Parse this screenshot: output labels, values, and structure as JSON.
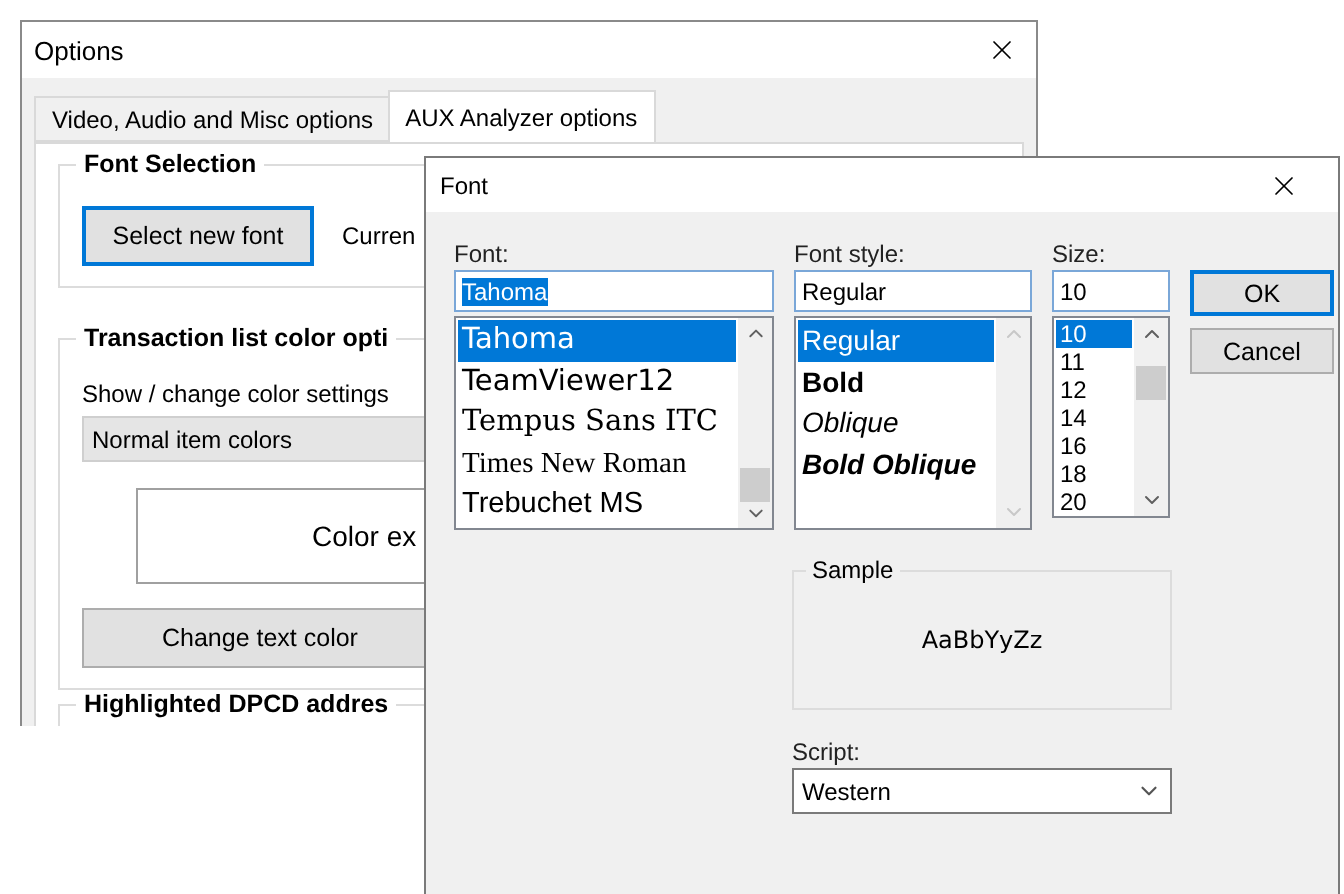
{
  "options_window": {
    "title": "Options",
    "tabs": [
      {
        "label": "Video, Audio and Misc options",
        "selected": false
      },
      {
        "label": "AUX Analyzer options",
        "selected": true
      }
    ],
    "font_selection": {
      "heading": "Font Selection",
      "button": {
        "label": "Select new font",
        "focused": true
      },
      "current_label": "Curren"
    },
    "color_options": {
      "heading": "Transaction list color opti",
      "prompt": "Show / change color settings",
      "dropdown_value": "Normal item colors",
      "example_text": "Color ex",
      "button": {
        "label": "Change text color",
        "focused": false
      }
    },
    "dpcd": {
      "heading": "Highlighted DPCD addres"
    }
  },
  "font_dialog": {
    "title": "Font",
    "font": {
      "label": "Font:",
      "value": "Tahoma",
      "items": [
        {
          "label": "Tahoma",
          "selected": true
        },
        {
          "label": "TeamViewer12",
          "selected": false
        },
        {
          "label": "Tempus Sans ITC",
          "selected": false
        },
        {
          "label": "Times New Roman",
          "selected": false
        },
        {
          "label": "Trebuchet MS",
          "selected": false
        }
      ]
    },
    "style": {
      "label": "Font style:",
      "value": "Regular",
      "items": [
        {
          "label": "Regular",
          "selected": true
        },
        {
          "label": "Bold",
          "selected": false
        },
        {
          "label": "Oblique",
          "selected": false
        },
        {
          "label": "Bold Oblique",
          "selected": false
        }
      ]
    },
    "size": {
      "label": "Size:",
      "value": "10",
      "items": [
        {
          "label": "10",
          "selected": true
        },
        {
          "label": "11",
          "selected": false
        },
        {
          "label": "12",
          "selected": false
        },
        {
          "label": "14",
          "selected": false
        },
        {
          "label": "16",
          "selected": false
        },
        {
          "label": "18",
          "selected": false
        },
        {
          "label": "20",
          "selected": false
        }
      ]
    },
    "buttons": [
      {
        "label": "OK",
        "default": true
      },
      {
        "label": "Cancel",
        "default": false
      }
    ],
    "sample": {
      "heading": "Sample",
      "text": "AaBbYyZz"
    },
    "script": {
      "label": "Script:",
      "value": "Western"
    }
  }
}
